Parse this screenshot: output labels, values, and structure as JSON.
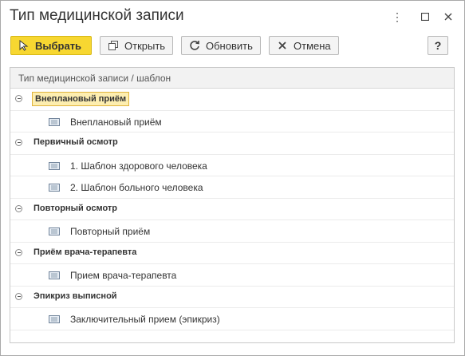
{
  "window": {
    "title": "Тип медицинской записи",
    "controls": [
      "more-icon",
      "maximize-icon",
      "close-icon"
    ]
  },
  "toolbar": {
    "select_label": "Выбрать",
    "open_label": "Открыть",
    "refresh_label": "Обновить",
    "cancel_label": "Отмена",
    "help_label": "?"
  },
  "table": {
    "header": "Тип медицинской записи / шаблон",
    "groups": [
      {
        "label": "Внеплановый приём",
        "selected": true,
        "items": [
          "Внеплановый приём"
        ]
      },
      {
        "label": "Первичный осмотр",
        "items": [
          "1. Шаблон здорового человека",
          "2. Шаблон больного человека"
        ]
      },
      {
        "label": "Повторный осмотр",
        "items": [
          "Повторный приём"
        ]
      },
      {
        "label": "Приём врача-терапевта",
        "items": [
          "Прием врача-терапевта"
        ]
      },
      {
        "label": "Эпикриз выписной",
        "items": [
          "Заключительный прием (эпикриз)"
        ]
      }
    ]
  },
  "colors": {
    "primary_button": "#f7d731",
    "selection_fill": "#fdeeb0",
    "selection_border": "#e0b43c"
  }
}
